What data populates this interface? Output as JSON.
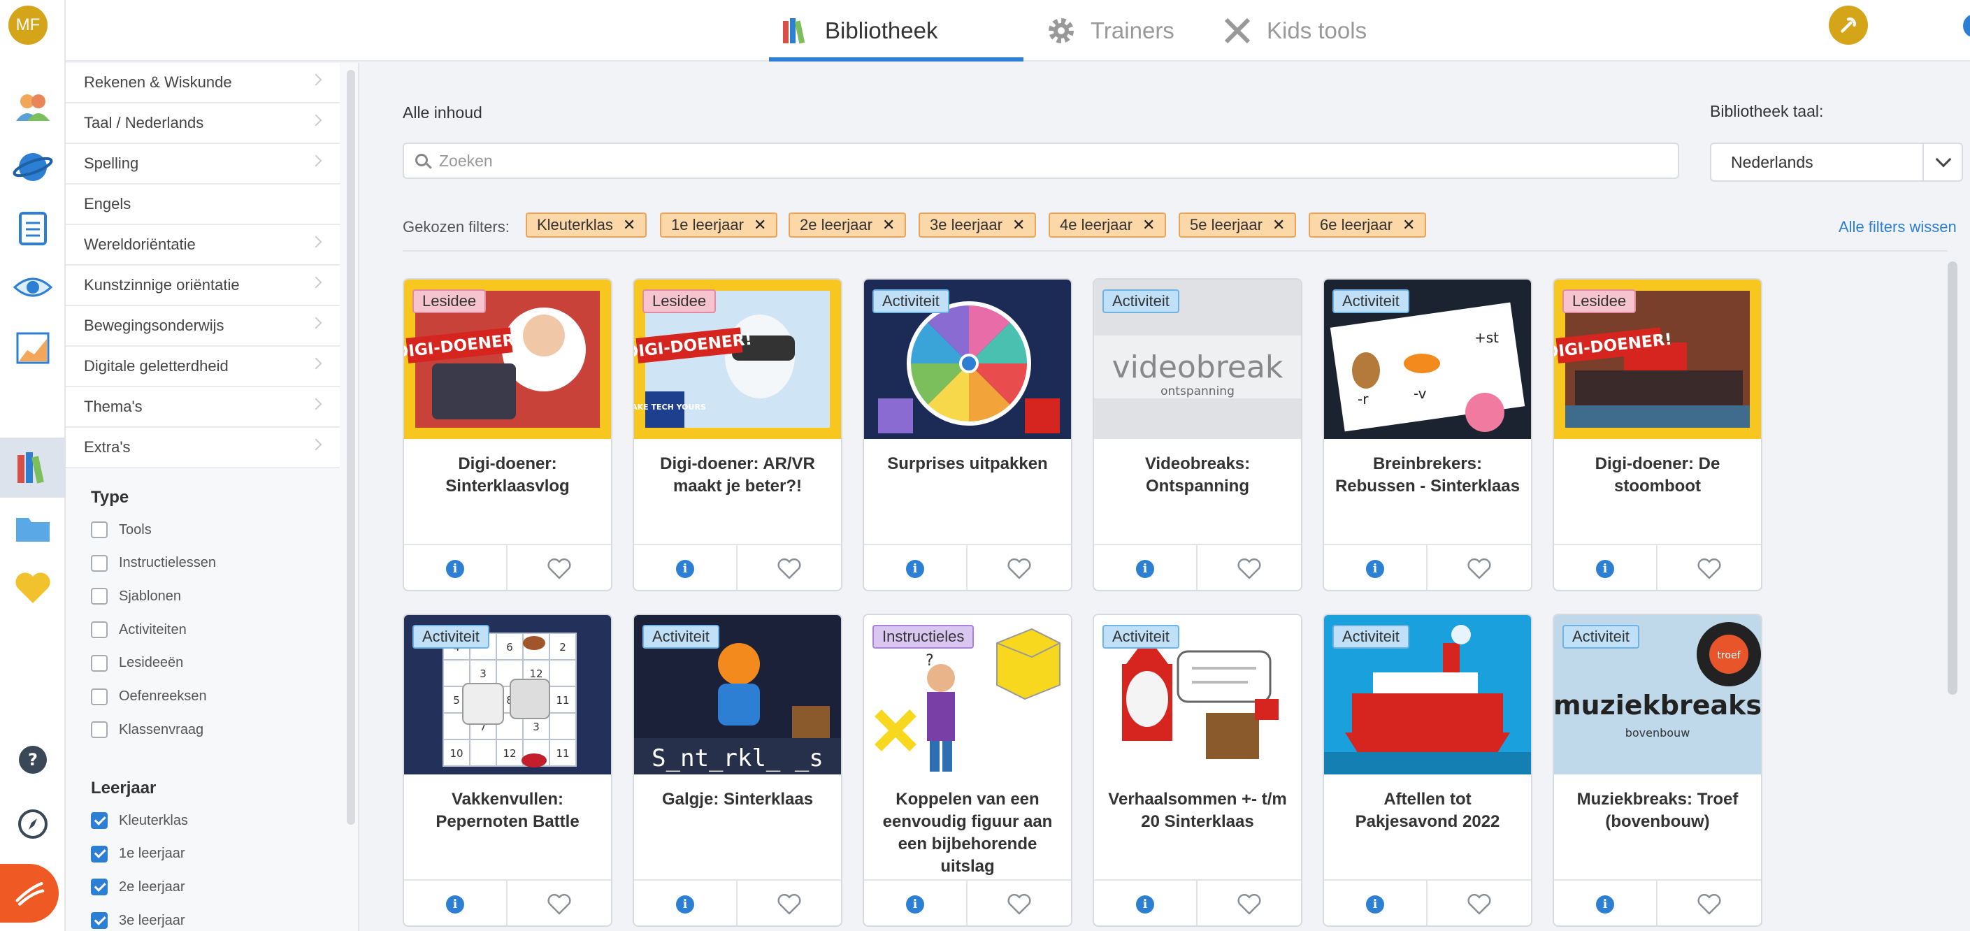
{
  "rail": {
    "avatar_initials": "MF",
    "items": [
      "users-icon",
      "planet-icon",
      "clipboard-icon",
      "eye-icon",
      "chart-icon",
      "books-icon",
      "folder-icon",
      "heart-icon"
    ],
    "bottom": [
      "help-icon",
      "compass-icon",
      "logo-icon"
    ]
  },
  "topbar": {
    "tabs": [
      {
        "label": "Bibliotheek",
        "icon": "books-icon",
        "active": true
      },
      {
        "label": "Trainers",
        "icon": "gear-icon",
        "active": false
      },
      {
        "label": "Kids tools",
        "icon": "tools-icon",
        "active": false
      }
    ]
  },
  "sidebar": {
    "categories": [
      {
        "label": "Rekenen & Wiskunde",
        "chevron": true
      },
      {
        "label": "Taal / Nederlands",
        "chevron": true
      },
      {
        "label": "Spelling",
        "chevron": true
      },
      {
        "label": "Engels",
        "chevron": false
      },
      {
        "label": "Wereldoriëntatie",
        "chevron": true
      },
      {
        "label": "Kunstzinnige oriëntatie",
        "chevron": true
      },
      {
        "label": "Bewegingsonderwijs",
        "chevron": true
      },
      {
        "label": "Digitale geletterdheid",
        "chevron": true
      },
      {
        "label": "Thema's",
        "chevron": true
      },
      {
        "label": "Extra's",
        "chevron": true
      }
    ],
    "type_heading": "Type",
    "types": [
      "Tools",
      "Instructielessen",
      "Sjablonen",
      "Activiteiten",
      "Lesideeën",
      "Oefenreeksen",
      "Klassenvraag"
    ],
    "leerjaar_heading": "Leerjaar",
    "leerjaren": [
      "Kleuterklas",
      "1e leerjaar",
      "2e leerjaar",
      "3e leerjaar"
    ]
  },
  "main": {
    "all_label": "Alle inhoud",
    "search_placeholder": "Zoeken",
    "lang_label": "Bibliotheek taal:",
    "lang_value": "Nederlands",
    "chosen_label": "Gekozen filters:",
    "chips": [
      "Kleuterklas",
      "1e leerjaar",
      "2e leerjaar",
      "3e leerjaar",
      "4e leerjaar",
      "5e leerjaar",
      "6e leerjaar"
    ],
    "clear_all": "Alle filters wissen"
  },
  "cards": [
    {
      "badge": "Lesidee",
      "kind": "lesidee",
      "title": "Digi-doener: Sinterklaasvlog",
      "thumb_text": "DIGI-DOENER!"
    },
    {
      "badge": "Lesidee",
      "kind": "lesidee",
      "title": "Digi-doener: AR/VR maakt je beter?!",
      "thumb_text": "DIGI-DOENER!",
      "thumb_sub": "MAKE TECH YOURS"
    },
    {
      "badge": "Activiteit",
      "kind": "activiteit",
      "title": "Surprises uitpakken"
    },
    {
      "badge": "Activiteit",
      "kind": "activiteit",
      "title": "Videobreaks: Ontspanning",
      "thumb_text": "videobreak",
      "thumb_sub": "ontspanning"
    },
    {
      "badge": "Activiteit",
      "kind": "activiteit",
      "title": "Breinbrekers: Rebussen - Sinterklaas",
      "thumb_labels": [
        "-r",
        "-v",
        "+st"
      ]
    },
    {
      "badge": "Lesidee",
      "kind": "lesidee",
      "title": "Digi-doener: De stoomboot",
      "thumb_text": "DIGI-DOENER!"
    },
    {
      "badge": "Activiteit",
      "kind": "activiteit",
      "title": "Vakkenvullen: Pepernoten Battle",
      "thumb_numbers": [
        "4",
        "6",
        "2",
        "3",
        "12",
        "5",
        "8",
        "11",
        "7",
        "3",
        "10",
        "12",
        "11",
        "5"
      ]
    },
    {
      "badge": "Activiteit",
      "kind": "activiteit",
      "title": "Galgje: Sinterklaas",
      "thumb_text": "S_nt_rkl_ _s"
    },
    {
      "badge": "Instructieles",
      "kind": "instructieles",
      "title": "Koppelen van een eenvoudig figuur aan een bijbehorende uitslag",
      "thumb_text": "?"
    },
    {
      "badge": "Activiteit",
      "kind": "activiteit",
      "title": "Verhaalsommen +- t/m 20 Sinterklaas"
    },
    {
      "badge": "Activiteit",
      "kind": "activiteit",
      "title": "Aftellen tot Pakjesavond 2022"
    },
    {
      "badge": "Activiteit",
      "kind": "activiteit",
      "title": "Muziekbreaks: Troef (bovenbouw)",
      "thumb_text": "muziekbreaks",
      "thumb_sub": "bovenbouw",
      "thumb_disc": "troef"
    }
  ]
}
